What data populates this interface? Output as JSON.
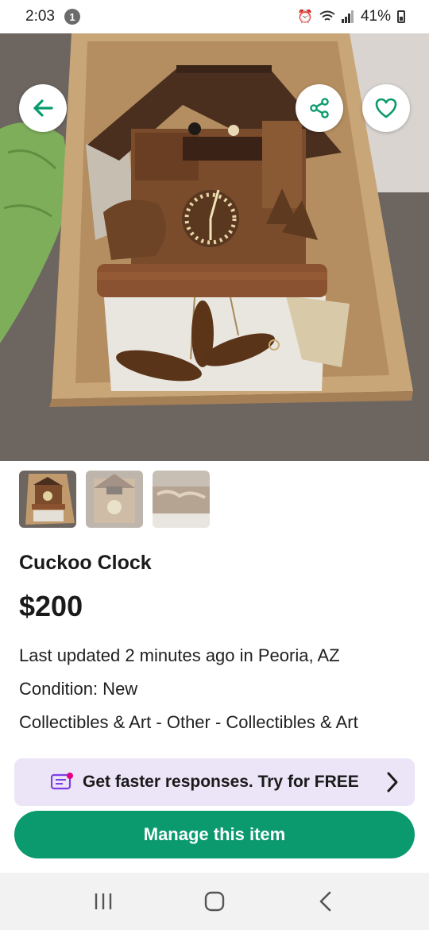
{
  "status_bar": {
    "time": "2:03",
    "notification_count": "1",
    "battery": "41%"
  },
  "listing": {
    "title": "Cuckoo Clock",
    "price": "$200",
    "updated": "Last updated 2 minutes ago in Peoria, AZ",
    "condition": "Condition: New",
    "category": "Collectibles & Art - Other - Collectibles & Art",
    "photo_count": 3,
    "selected_photo": 1
  },
  "promo": {
    "text": "Get faster responses. Try for FREE"
  },
  "actions": {
    "manage_label": "Manage this item"
  },
  "icons": {
    "back": "arrow-left-icon",
    "share": "share-icon",
    "favorite": "heart-icon",
    "promo": "message-icon",
    "chevron": "chevron-right-icon",
    "nav_recents": "recents-icon",
    "nav_home": "home-icon",
    "nav_back": "back-icon"
  },
  "colors": {
    "brand_green": "#0b9a6d",
    "promo_bg": "#ece4f7",
    "promo_accent": "#7b3fe4",
    "badge_pink": "#e6007e"
  }
}
